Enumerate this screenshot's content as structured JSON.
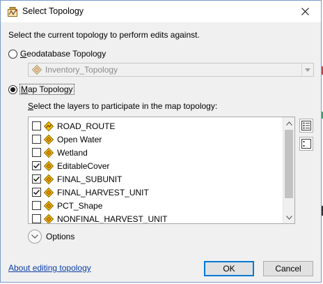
{
  "window": {
    "title": "Select Topology"
  },
  "instruction": "Select the current topology to perform edits against.",
  "geodatabase": {
    "prefix": "",
    "accesskey": "G",
    "rest": "eodatabase Topology",
    "selected": false,
    "combo_value": "Inventory_Topology"
  },
  "map_topology": {
    "accesskey": "M",
    "rest": "ap Topology",
    "selected": true
  },
  "layers_label_parts": {
    "before": "",
    "accesskey": "S",
    "after": "elect the layers to participate in the map topology:"
  },
  "layers": [
    {
      "name": "ROAD_ROUTE",
      "checked": false,
      "icon": "line-feature-icon"
    },
    {
      "name": "Open Water",
      "checked": false,
      "icon": "polygon-feature-icon"
    },
    {
      "name": "Wetland",
      "checked": false,
      "icon": "polygon-feature-icon"
    },
    {
      "name": "EditableCover",
      "checked": true,
      "icon": "polygon-feature-icon"
    },
    {
      "name": "FINAL_SUBUNIT",
      "checked": true,
      "icon": "polygon-feature-icon"
    },
    {
      "name": "FINAL_HARVEST_UNIT",
      "checked": true,
      "icon": "polygon-feature-icon"
    },
    {
      "name": "PCT_Shape",
      "checked": false,
      "icon": "polygon-feature-icon"
    },
    {
      "name": "NONFINAL_HARVEST_UNIT",
      "checked": false,
      "icon": "polygon-feature-icon"
    }
  ],
  "options_label": "Options",
  "help_link": "About editing topology",
  "buttons": {
    "ok": "OK",
    "cancel": "Cancel"
  },
  "colors": {
    "accent": "#0078d7",
    "link": "#0a3ea8",
    "dialog_bg": "#f0f0f0",
    "layer_icon_yellow": "#f5c400",
    "layer_icon_orange": "#e08a00"
  }
}
